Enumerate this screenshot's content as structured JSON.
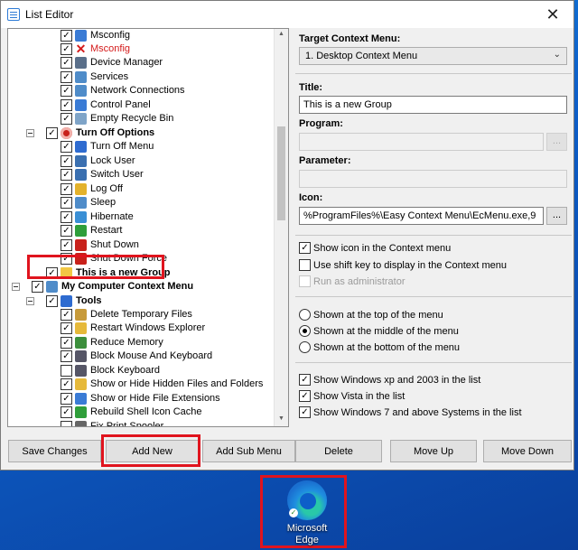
{
  "window": {
    "title": "List Editor",
    "close_glyph": "✕"
  },
  "tree": {
    "items": [
      {
        "label": "Msconfig",
        "icon": "msconfig-icon"
      },
      {
        "label": "Msconfig",
        "icon": "red-x-icon",
        "color": "#d41a1a"
      },
      {
        "label": "Device Manager",
        "icon": "device-manager-icon"
      },
      {
        "label": "Services",
        "icon": "services-icon"
      },
      {
        "label": "Network Connections",
        "icon": "network-icon"
      },
      {
        "label": "Control Panel",
        "icon": "control-panel-icon"
      },
      {
        "label": "Empty Recycle Bin",
        "icon": "recycle-bin-icon"
      },
      {
        "label": "Turn Off Options",
        "icon": "power-icon"
      },
      {
        "label": "Turn Off Menu",
        "icon": "arrow-icon"
      },
      {
        "label": "Lock User",
        "icon": "lock-icon"
      },
      {
        "label": "Switch User",
        "icon": "switch-user-icon"
      },
      {
        "label": "Log Off",
        "icon": "log-off-icon"
      },
      {
        "label": "Sleep",
        "icon": "sleep-icon"
      },
      {
        "label": "Hibernate",
        "icon": "hibernate-icon"
      },
      {
        "label": "Restart",
        "icon": "restart-icon"
      },
      {
        "label": "Shut Down",
        "icon": "shutdown-icon"
      },
      {
        "label": "Shut Down Force",
        "icon": "shutdown-force-icon"
      },
      {
        "label": "This is a new Group",
        "icon": "folder-icon"
      },
      {
        "label": "My Computer Context Menu",
        "icon": "computer-icon"
      },
      {
        "label": "Tools",
        "icon": "arrow-icon"
      },
      {
        "label": "Delete Temporary Files",
        "icon": "broom-icon"
      },
      {
        "label": "Restart Windows Explorer",
        "icon": "explorer-icon"
      },
      {
        "label": "Reduce Memory",
        "icon": "memory-icon"
      },
      {
        "label": "Block Mouse And Keyboard",
        "icon": "keyboard-icon"
      },
      {
        "label": "Block Keyboard",
        "icon": "keyboard-icon"
      },
      {
        "label": "Show or Hide Hidden Files and Folders",
        "icon": "hidden-files-icon"
      },
      {
        "label": "Show or Hide File Extensions",
        "icon": "file-extensions-icon"
      },
      {
        "label": "Rebuild Shell Icon Cache",
        "icon": "rebuild-icon"
      },
      {
        "label": "Fix Print Spooler",
        "icon": "printer-icon"
      }
    ]
  },
  "form": {
    "target_label": "Target Context Menu:",
    "target_value": "1. Desktop Context Menu",
    "title_label": "Title:",
    "title_value": "This is a new Group",
    "program_label": "Program:",
    "program_value": "",
    "parameter_label": "Parameter:",
    "parameter_value": "",
    "icon_label": "Icon:",
    "icon_value": "%ProgramFiles%\\Easy Context Menu\\EcMenu.exe,9",
    "browse_label": "...",
    "chevron": "⌄"
  },
  "options": {
    "show_icon": "Show icon in the Context menu",
    "use_shift": "Use shift key to display in the Context menu",
    "run_admin": "Run as administrator",
    "pos_top": "Shown at the top of the menu",
    "pos_middle": "Shown at the middle of the menu",
    "pos_bottom": "Shown at the bottom of the menu",
    "win_xp": "Show Windows xp  and 2003 in the list",
    "win_vista": "Show Vista in the list",
    "win_7": "Show Windows 7 and above Systems in the list",
    "check_glyph": "✓"
  },
  "buttons": {
    "save": "Save Changes",
    "add_new": "Add New",
    "add_sub": "Add Sub Menu",
    "delete": "Delete",
    "move_up": "Move Up",
    "move_down": "Move Down"
  },
  "desktop": {
    "edge_label_1": "Microsoft",
    "edge_label_2": "Edge",
    "check_glyph": "✓"
  },
  "colors": {
    "highlight": "#e0141e",
    "accent": "#0d5fc9"
  }
}
